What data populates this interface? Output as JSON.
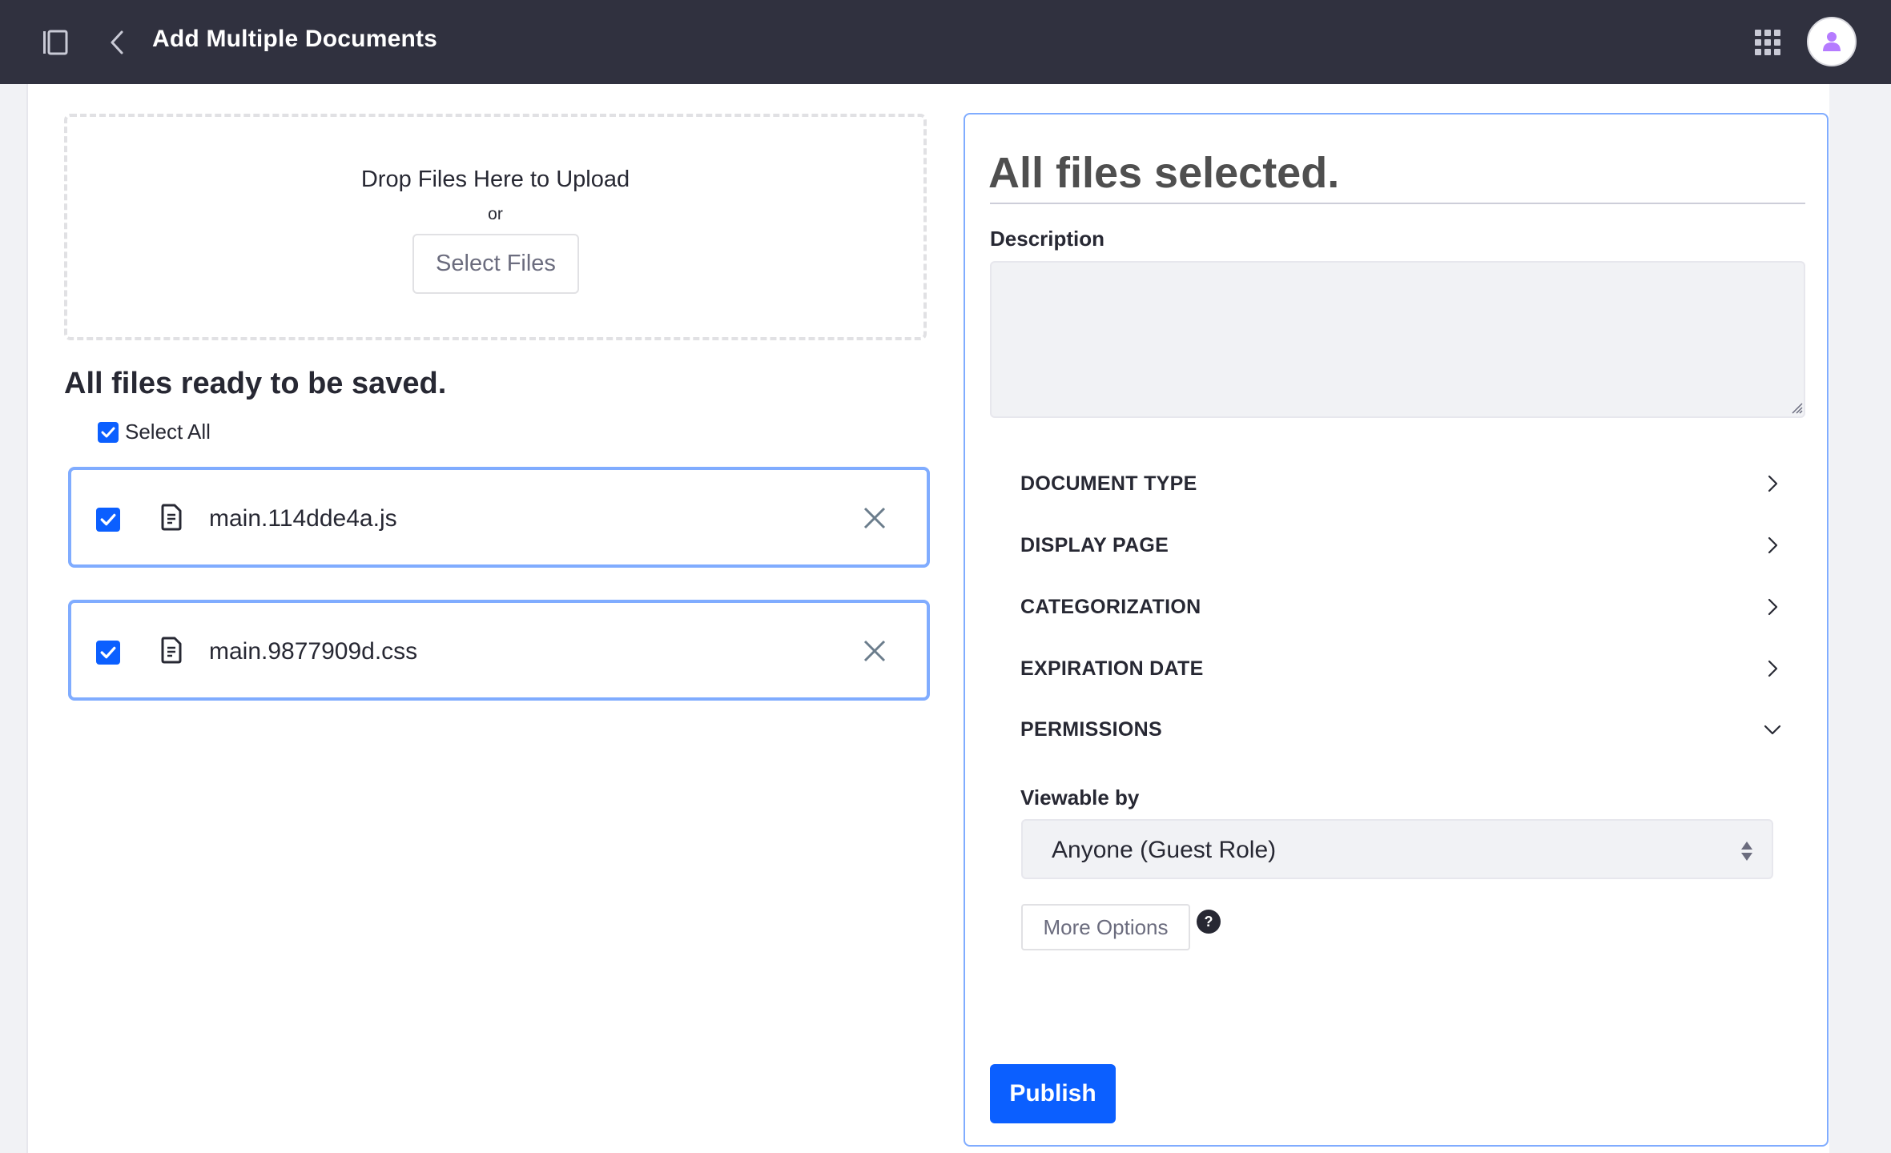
{
  "header": {
    "title": "Add Multiple Documents",
    "icons": {
      "sidebar_toggle": "sidebar-panel-icon",
      "back": "chevron-left-icon",
      "apps": "grid-apps-icon",
      "avatar": "user-icon"
    }
  },
  "upload": {
    "drop_text": "Drop Files Here to Upload",
    "or_text": "or",
    "select_files_label": "Select Files"
  },
  "files_section": {
    "heading": "All files ready to be saved.",
    "select_all_label": "Select All",
    "select_all_checked": true,
    "files": [
      {
        "name": "main.114dde4a.js",
        "checked": true
      },
      {
        "name": "main.9877909d.css",
        "checked": true
      }
    ]
  },
  "panel": {
    "title": "All files selected.",
    "description_label": "Description",
    "description_value": "",
    "sections": [
      {
        "label": "DOCUMENT TYPE",
        "expanded": false
      },
      {
        "label": "DISPLAY PAGE",
        "expanded": false
      },
      {
        "label": "CATEGORIZATION",
        "expanded": false
      },
      {
        "label": "EXPIRATION DATE",
        "expanded": false
      },
      {
        "label": "PERMISSIONS",
        "expanded": true
      }
    ],
    "permissions": {
      "viewable_by_label": "Viewable by",
      "viewable_by_value": "Anyone (Guest Role)",
      "more_options_label": "More Options",
      "help_glyph": "?"
    },
    "publish_label": "Publish"
  },
  "colors": {
    "header_bg": "#30313f",
    "primary": "#0b5fff",
    "row_border": "#80acff",
    "avatar_accent": "#b57bff",
    "page_bg": "#f1f2f5"
  }
}
